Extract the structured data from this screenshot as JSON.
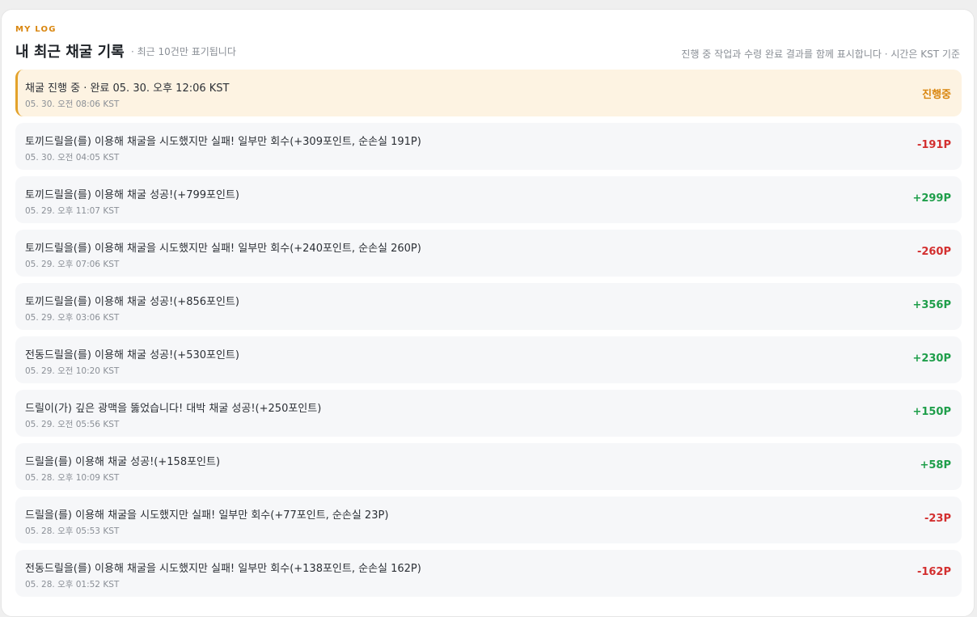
{
  "header": {
    "eyebrow": "MY LOG",
    "title": "내 최근 채굴 기록",
    "subtitle": "· 최근 10건만 표기됩니다",
    "note": "진행 중 작업과 수령 완료 결과를 함께 표시합니다 · 시간은 KST 기준"
  },
  "colors": {
    "accent": "#d9860f",
    "positive": "#1e9e4a",
    "negative": "#d32f2f",
    "active_bg": "#fdf3e2"
  },
  "logs": [
    {
      "message": "채굴 진행 중 · 완료 05. 30. 오후 12:06 KST",
      "time": "05. 30. 오전 08:06 KST",
      "value": "진행중",
      "status": "progress"
    },
    {
      "message": "토끼드릴을(를) 이용해 채굴을 시도했지만 실패! 일부만 회수(+309포인트, 순손실 191P)",
      "time": "05. 30. 오전 04:05 KST",
      "value": "-191P",
      "status": "negative"
    },
    {
      "message": "토끼드릴을(를) 이용해 채굴 성공!(+799포인트)",
      "time": "05. 29. 오후 11:07 KST",
      "value": "+299P",
      "status": "positive"
    },
    {
      "message": "토끼드릴을(를) 이용해 채굴을 시도했지만 실패! 일부만 회수(+240포인트, 순손실 260P)",
      "time": "05. 29. 오후 07:06 KST",
      "value": "-260P",
      "status": "negative"
    },
    {
      "message": "토끼드릴을(를) 이용해 채굴 성공!(+856포인트)",
      "time": "05. 29. 오후 03:06 KST",
      "value": "+356P",
      "status": "positive"
    },
    {
      "message": "전동드릴을(를) 이용해 채굴 성공!(+530포인트)",
      "time": "05. 29. 오전 10:20 KST",
      "value": "+230P",
      "status": "positive"
    },
    {
      "message": "드릴이(가) 깊은 광맥을 뚫었습니다! 대박 채굴 성공!(+250포인트)",
      "time": "05. 29. 오전 05:56 KST",
      "value": "+150P",
      "status": "positive"
    },
    {
      "message": "드릴을(를) 이용해 채굴 성공!(+158포인트)",
      "time": "05. 28. 오후 10:09 KST",
      "value": "+58P",
      "status": "positive"
    },
    {
      "message": "드릴을(를) 이용해 채굴을 시도했지만 실패! 일부만 회수(+77포인트, 순손실 23P)",
      "time": "05. 28. 오후 05:53 KST",
      "value": "-23P",
      "status": "negative"
    },
    {
      "message": "전동드릴을(를) 이용해 채굴을 시도했지만 실패! 일부만 회수(+138포인트, 순손실 162P)",
      "time": "05. 28. 오후 01:52 KST",
      "value": "-162P",
      "status": "negative"
    }
  ]
}
